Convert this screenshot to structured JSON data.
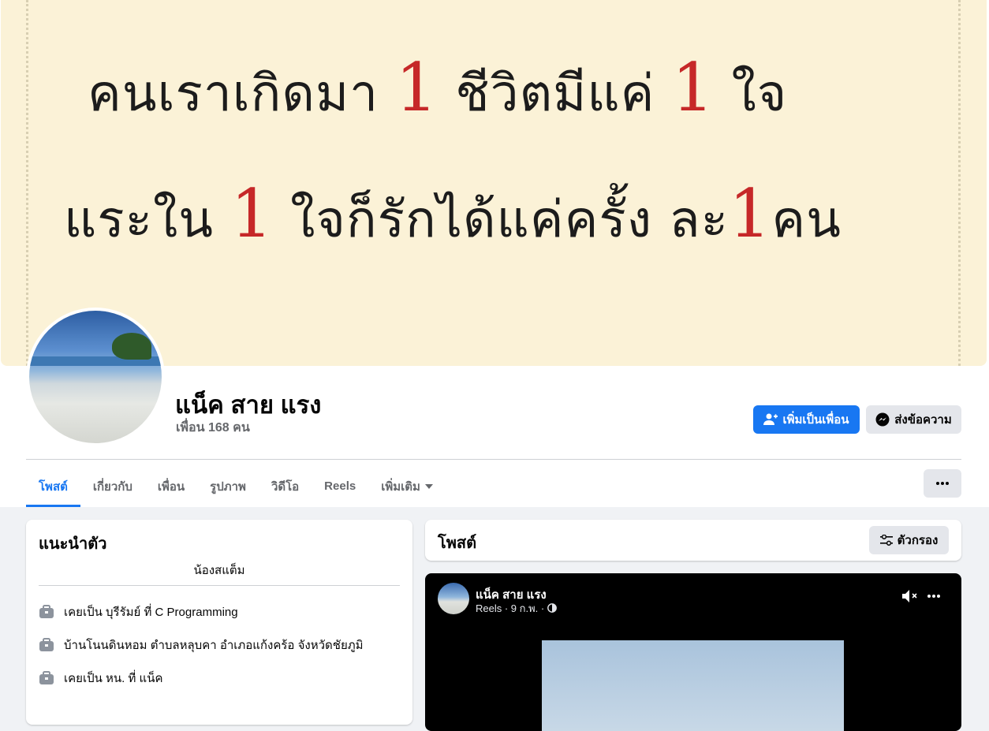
{
  "cover": {
    "line1_a": "คนเราเกิดมา ",
    "line1_num1": "1",
    "line1_b": " ชีวิตมีแค่ ",
    "line1_num2": "1",
    "line1_c": " ใจ",
    "line2_a": "แระใน ",
    "line2_num1": "1",
    "line2_b": " ใจก็รักได้แค่ครั้ง ละ",
    "line2_num2": "1",
    "line2_c": "คน"
  },
  "profile": {
    "name": "แน็ค สาย แรง",
    "friends": "เพื่อน 168 คน"
  },
  "actions": {
    "add_friend": "เพิ่มเป็นเพื่อน",
    "message": "ส่งข้อความ"
  },
  "tabs": [
    "โพสต์",
    "เกี่ยวกับ",
    "เพื่อน",
    "รูปภาพ",
    "วิดีโอ",
    "Reels",
    "เพิ่มเติม"
  ],
  "intro": {
    "title": "แนะนำตัว",
    "bio": "น้องสแต็ม",
    "items": [
      "เคยเป็น บุรีรัมย์ ที่ C Programming",
      "บ้านโนนดินหอม ตำบลหลุบคา อำเภอแก้งคร้อ จังหวัดชัยภูมิ",
      "เคยเป็น หน. ที่ แน็ค"
    ]
  },
  "posts": {
    "title": "โพสต์",
    "filter": "ตัวกรอง"
  },
  "reel_post": {
    "author": "แน็ค สาย แรง",
    "meta": "Reels · 9 ก.พ. ·"
  },
  "colors": {
    "accent": "#1877f2",
    "cover_bg": "#fbf2d7",
    "page_bg": "#f0f2f5"
  }
}
